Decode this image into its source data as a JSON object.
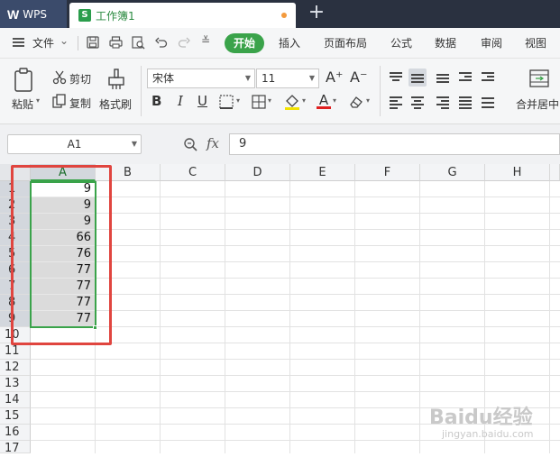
{
  "titlebar": {
    "app_name": "WPS",
    "doc_tab": "工作簿1",
    "doc_icon_letter": "S",
    "new_tab_symbol": "+"
  },
  "menubar": {
    "file": "文件",
    "file_chevron": "⌄",
    "more_symbol": "≚",
    "tabs": [
      "开始",
      "插入",
      "页面布局",
      "公式",
      "数据",
      "审阅",
      "视图"
    ],
    "active_tab": "开始"
  },
  "ribbon": {
    "paste": "粘贴",
    "cut": "剪切",
    "copy": "复制",
    "format_painter": "格式刷",
    "font_name": "宋体",
    "font_size": "11",
    "increase_font": "A⁺",
    "decrease_font": "A⁻",
    "bold": "B",
    "italic": "I",
    "underline": "U",
    "font_color_letter": "A",
    "merge_center": "合并居中"
  },
  "formula_bar": {
    "cell_ref": "A1",
    "fx_label": "fx",
    "value": "9"
  },
  "grid": {
    "columns": [
      "A",
      "B",
      "C",
      "D",
      "E",
      "F",
      "G",
      "H"
    ],
    "selected_column": "A",
    "rows": [
      "1",
      "2",
      "3",
      "4",
      "5",
      "6",
      "7",
      "8",
      "9",
      "10",
      "11",
      "12",
      "13",
      "14",
      "15",
      "16",
      "17"
    ],
    "column_a_values": [
      "9",
      "9",
      "9",
      "66",
      "76",
      "77",
      "77",
      "77",
      "77"
    ],
    "accent_green": "#3aa34a",
    "highlight_red": "#e0453f"
  },
  "watermark": {
    "main": "Baidu经验",
    "sub": "jingyan.baidu.com"
  }
}
